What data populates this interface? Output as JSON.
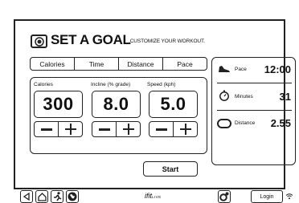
{
  "header": {
    "title": "SET A GOAL",
    "subtitle": ".CUSTOMIZE YOUR WORKOUT."
  },
  "tabs": [
    {
      "label": "Calories"
    },
    {
      "label": "Time"
    },
    {
      "label": "Distance"
    },
    {
      "label": "Pace"
    }
  ],
  "goal_panel": {
    "fields": [
      {
        "label": "Calories",
        "value": "300"
      },
      {
        "label": "Incline (% grade)",
        "value": "8.0"
      },
      {
        "label": "Speed (kph)",
        "value": "5.0"
      }
    ]
  },
  "start_label": "Start",
  "stats": [
    {
      "icon": "shoe-icon",
      "label": "Pace",
      "value": "12:00"
    },
    {
      "icon": "stopwatch-icon",
      "label": "Minutes",
      "value": "31"
    },
    {
      "icon": "track-icon",
      "label": "Distance",
      "value": "2.55"
    }
  ],
  "bottom_bar": {
    "brand": "ifit",
    "brand_suffix": "LIVE",
    "login_label": "Login",
    "nav_icons": [
      "back-icon",
      "home-icon",
      "runner-icon",
      "globe-icon"
    ],
    "settings_icon": "settings-icon",
    "wifi_icon": "wifi-icon"
  }
}
